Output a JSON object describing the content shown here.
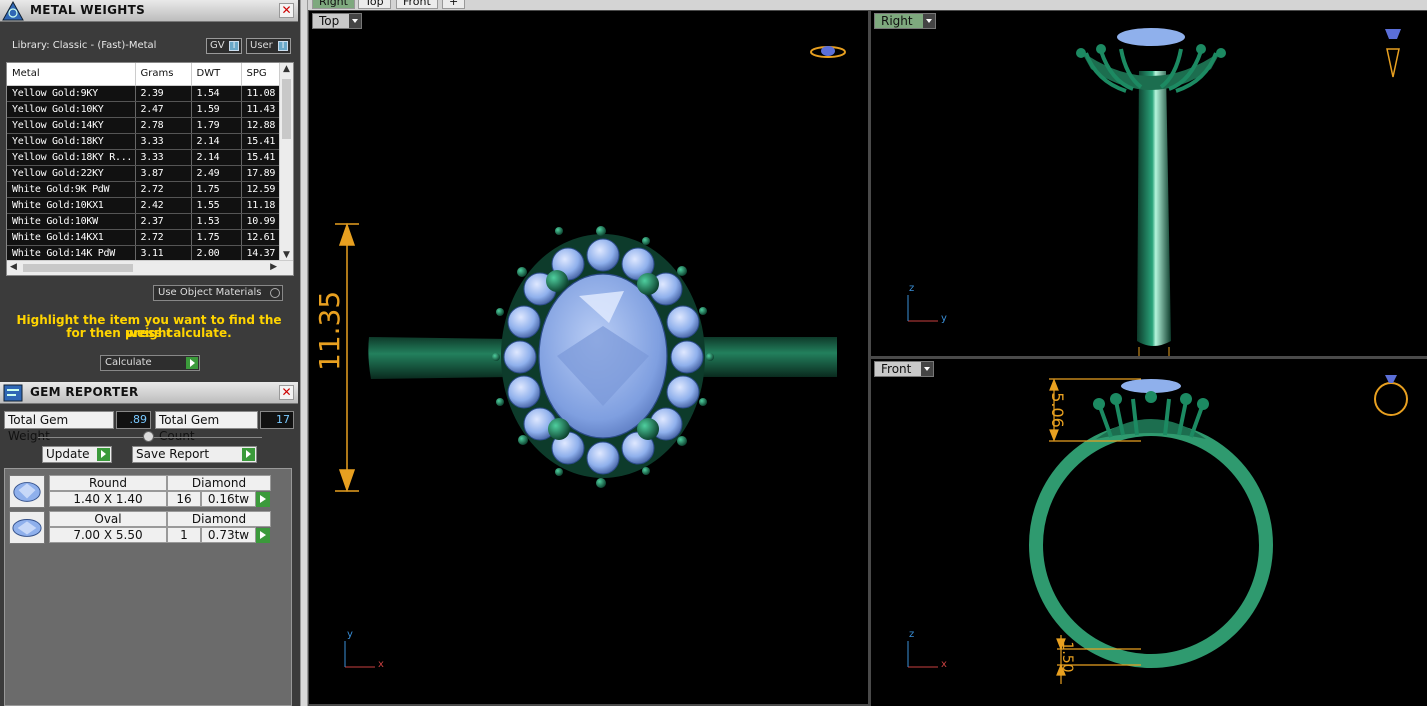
{
  "metal_weights": {
    "title": "METAL WEIGHTS",
    "library": "Library: Classic - (Fast)-Metal",
    "gv_label": "GV",
    "user_label": "User",
    "toggle_mark": "I",
    "columns": [
      "Metal",
      "Grams",
      "DWT",
      "SPG"
    ],
    "rows": [
      [
        "Yellow Gold:9KY",
        "2.39",
        "1.54",
        "11.08"
      ],
      [
        "Yellow Gold:10KY",
        "2.47",
        "1.59",
        "11.43"
      ],
      [
        "Yellow Gold:14KY",
        "2.78",
        "1.79",
        "12.88"
      ],
      [
        "Yellow Gold:18KY",
        "3.33",
        "2.14",
        "15.41"
      ],
      [
        "Yellow Gold:18KY R...",
        "3.33",
        "2.14",
        "15.41"
      ],
      [
        "Yellow Gold:22KY",
        "3.87",
        "2.49",
        "17.89"
      ],
      [
        "White Gold:9K PdW",
        "2.72",
        "1.75",
        "12.59"
      ],
      [
        "White Gold:10KX1",
        "2.42",
        "1.55",
        "11.18"
      ],
      [
        "White Gold:10KW",
        "2.37",
        "1.53",
        "10.99"
      ],
      [
        "White Gold:14KX1",
        "2.72",
        "1.75",
        "12.61"
      ],
      [
        "White Gold:14K PdW",
        "3.11",
        "2.00",
        "14.37"
      ]
    ],
    "use_object_materials": "Use Object Materials",
    "hint_line1": "Highlight the item you want to find the weight",
    "hint_line2": "for then press calculate.",
    "calculate": "Calculate"
  },
  "gem_reporter": {
    "title": "GEM REPORTER",
    "total_weight_label": "Total Gem Weight",
    "total_weight_value": ".89",
    "total_count_label": "Total Gem Count",
    "total_count_value": "17",
    "update": "Update",
    "save_report": "Save Report",
    "gems": [
      {
        "shape": "Round",
        "material": "Diamond",
        "size": "1.40 X 1.40",
        "count": "16",
        "weight": "0.16tw"
      },
      {
        "shape": "Oval",
        "material": "Diamond",
        "size": "7.00 X 5.50",
        "count": "1",
        "weight": "0.73tw"
      }
    ]
  },
  "tabs": [
    "Right",
    "Top",
    "Front",
    "+"
  ],
  "viewports": {
    "top": {
      "label": "Top",
      "dimension": "11.35",
      "axis_a": "y",
      "axis_b": "x"
    },
    "right": {
      "label": "Right",
      "axis_a": "z",
      "axis_b": "y"
    },
    "front": {
      "label": "Front",
      "dimension_a": "5.06",
      "dimension_b": "1.50",
      "axis_a": "z",
      "axis_b": "x"
    }
  },
  "colors": {
    "metal": "#1c6e4f",
    "gem": "#8fb0ec",
    "dimension": "#e8a020",
    "label_active": "#7ea97e",
    "label_inactive": "#c9c9c9"
  }
}
